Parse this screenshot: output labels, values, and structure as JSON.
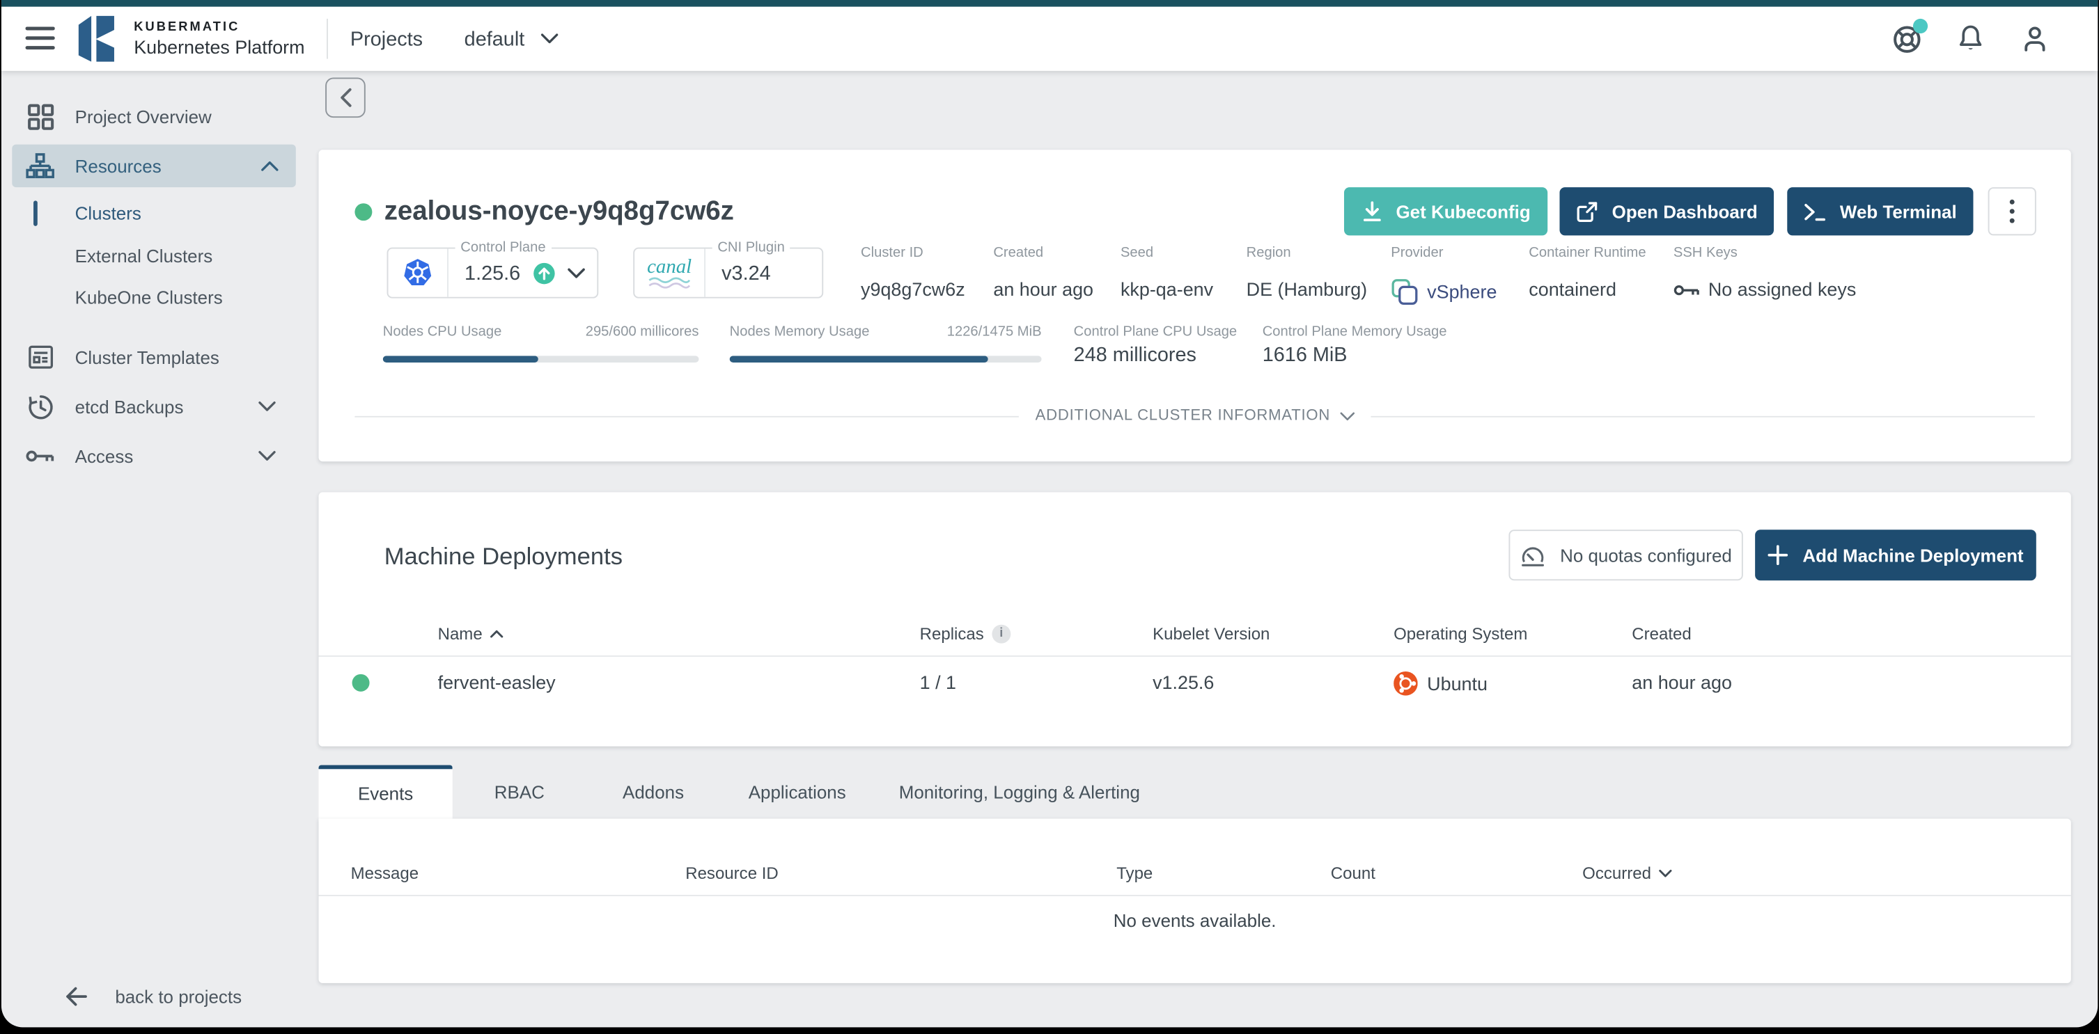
{
  "header": {
    "brand_top": "KUBERMATIC",
    "brand_bottom": "Kubernetes Platform",
    "nav_title": "Projects",
    "project_selector": "default"
  },
  "sidebar": {
    "project_overview": "Project Overview",
    "resources": "Resources",
    "clusters": "Clusters",
    "external_clusters": "External Clusters",
    "kubeone_clusters": "KubeOne Clusters",
    "cluster_templates": "Cluster Templates",
    "etcd_backups": "etcd Backups",
    "access": "Access",
    "back_to_projects": "back to projects"
  },
  "cluster": {
    "name": "zealous-noyce-y9q8g7cw6z",
    "status": "healthy",
    "buttons": {
      "get_kubeconfig": "Get Kubeconfig",
      "open_dashboard": "Open Dashboard",
      "web_terminal": "Web Terminal"
    },
    "control_plane": {
      "label": "Control Plane",
      "version": "1.25.6"
    },
    "cni_plugin": {
      "label": "CNI Plugin",
      "version": "v3.24",
      "logo_text": "canal"
    },
    "info": [
      {
        "label": "Cluster ID",
        "value": "y9q8g7cw6z"
      },
      {
        "label": "Created",
        "value": "an hour ago"
      },
      {
        "label": "Seed",
        "value": "kkp-qa-env"
      },
      {
        "label": "Region",
        "value": "DE (Hamburg)"
      },
      {
        "label": "Provider",
        "value": "vSphere"
      },
      {
        "label": "Container Runtime",
        "value": "containerd"
      },
      {
        "label": "SSH Keys",
        "value": "No assigned keys"
      }
    ],
    "usage": {
      "nodes_cpu": {
        "label": "Nodes CPU Usage",
        "value": "295/600 millicores",
        "percent": 49
      },
      "nodes_memory": {
        "label": "Nodes Memory Usage",
        "value": "1226/1475 MiB",
        "percent": 83
      },
      "control_plane_cpu": {
        "label": "Control Plane CPU Usage",
        "value": "248 millicores"
      },
      "control_plane_memory": {
        "label": "Control Plane Memory Usage",
        "value": "1616 MiB"
      }
    },
    "additional_info_label": "ADDITIONAL CLUSTER INFORMATION"
  },
  "machine_deployments": {
    "title": "Machine Deployments",
    "quota_button": "No quotas configured",
    "add_button": "Add Machine Deployment",
    "info_badge": "i",
    "columns": {
      "name": "Name",
      "replicas": "Replicas",
      "kubelet": "Kubelet Version",
      "os": "Operating System",
      "created": "Created"
    },
    "rows": [
      {
        "status": "healthy",
        "name": "fervent-easley",
        "replicas": "1 / 1",
        "kubelet": "v1.25.6",
        "os": "Ubuntu",
        "created": "an hour ago"
      }
    ]
  },
  "tabs": {
    "events": "Events",
    "rbac": "RBAC",
    "addons": "Addons",
    "applications": "Applications",
    "mla": "Monitoring, Logging & Alerting"
  },
  "events": {
    "columns": {
      "message": "Message",
      "resource_id": "Resource ID",
      "type": "Type",
      "count": "Count",
      "occurred": "Occurred"
    },
    "empty_message": "No events available."
  },
  "colors": {
    "top_strip": "#1A515F",
    "primary_navy": "#1E4C70",
    "accent_teal": "#4CB9B0",
    "status_green": "#4DBA87",
    "progress_fill": "#2D5D80",
    "kubernetes_blue": "#326CE5",
    "ubuntu_orange": "#E95420",
    "notification_badge_teal": "#4CC8C3"
  }
}
